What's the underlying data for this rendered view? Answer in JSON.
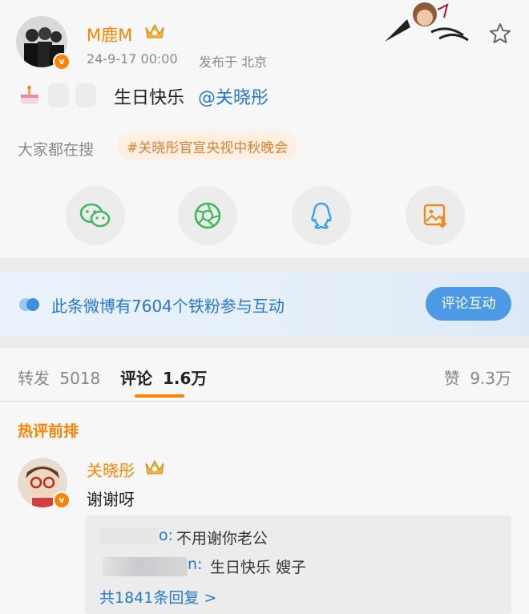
{
  "post": {
    "username": "M鹿M",
    "timestamp": "24-9-17 00:00",
    "location": "发布于 北京",
    "text": "生日快乐",
    "mention": "@关晓彤"
  },
  "search": {
    "label": "大家都在搜",
    "hashtag": "#关晓彤官宣央视中秋晚会"
  },
  "share_icons": [
    "wechat-icon",
    "moments-icon",
    "qq-icon",
    "save-image-icon"
  ],
  "fans_banner": {
    "text": "此条微博有7604个铁粉参与互动",
    "button": "评论互动"
  },
  "tabs": {
    "repost_label": "转发",
    "repost_count": "5018",
    "comment_label": "评论",
    "comment_count": "1.6万",
    "like_label": "赞",
    "like_count": "9.3万"
  },
  "hot_comments": {
    "title": "热评前排",
    "user": "关晓彤",
    "text": "谢谢呀",
    "replies": [
      {
        "user_suffix": "o:",
        "text": "不用谢你老公"
      },
      {
        "user_suffix": "n:",
        "text": "生日快乐 嫂子"
      }
    ],
    "more": "共1841条回复 >"
  },
  "colors": {
    "orange": "#ff8200",
    "link_blue": "#2577cf",
    "banner_button": "#4c9ae6",
    "hashtag_bg": "#fdf0e3",
    "hashtag_text": "#e47f2a"
  }
}
